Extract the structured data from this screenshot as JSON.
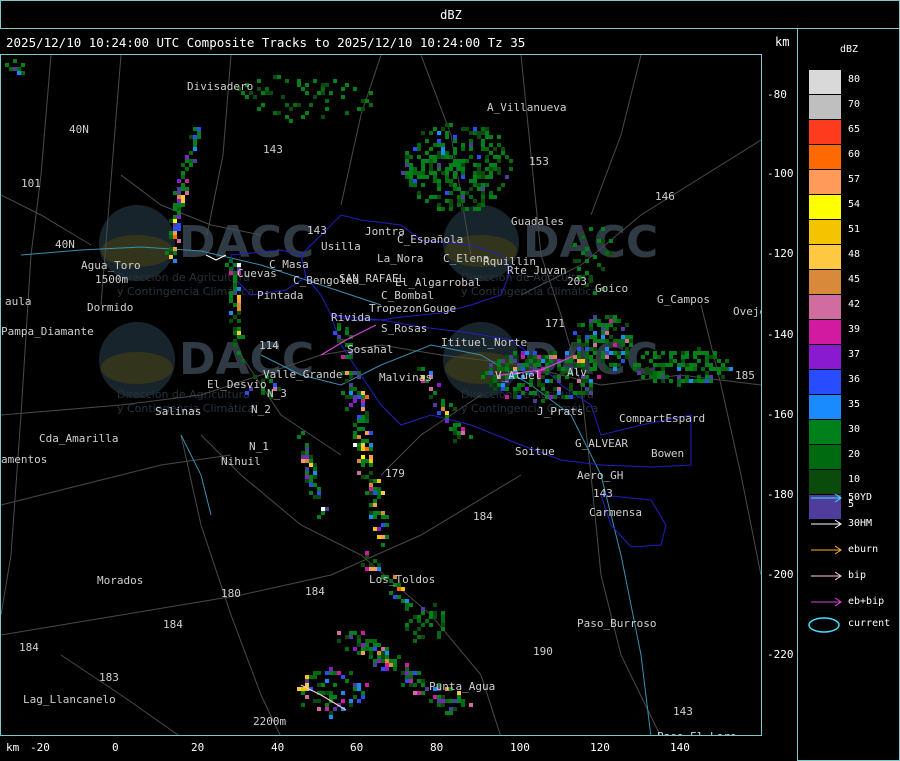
{
  "header": {
    "title": "dBZ"
  },
  "map_title": "2025/12/10 10:24:00 UTC Composite Tracks to 2025/12/10 10:24:00 Tz 35",
  "axis": {
    "unit": "km",
    "y_ticks": [
      "-80",
      "-100",
      "-120",
      "-140",
      "-160",
      "-180",
      "-200",
      "-220"
    ],
    "x_ticks": [
      "-20",
      "0",
      "20",
      "40",
      "60",
      "80",
      "100",
      "120",
      "140"
    ]
  },
  "legend": {
    "title": "dBZ",
    "levels": [
      {
        "label": "80",
        "color": "#d9d9d9"
      },
      {
        "label": "70",
        "color": "#bfbfbf"
      },
      {
        "label": "65",
        "color": "#ff3b1e"
      },
      {
        "label": "60",
        "color": "#ff6a00"
      },
      {
        "label": "57",
        "color": "#ff9a5a"
      },
      {
        "label": "54",
        "color": "#ffff00"
      },
      {
        "label": "51",
        "color": "#f5c400"
      },
      {
        "label": "48",
        "color": "#ffc840"
      },
      {
        "label": "45",
        "color": "#d88a3a"
      },
      {
        "label": "42",
        "color": "#d06ca0"
      },
      {
        "label": "39",
        "color": "#d21aa0"
      },
      {
        "label": "37",
        "color": "#8a1ad0"
      },
      {
        "label": "36",
        "color": "#2a4cff"
      },
      {
        "label": "35",
        "color": "#1a8aff"
      },
      {
        "label": "30",
        "color": "#00801a"
      },
      {
        "label": "20",
        "color": "#006a10"
      },
      {
        "label": "10",
        "color": "#0a4a0a"
      },
      {
        "label": "5",
        "color": "#503c9a"
      }
    ],
    "tracks": [
      {
        "label": "50YD",
        "color": "#40e0ff"
      },
      {
        "label": "30HM",
        "color": "#ffffff"
      },
      {
        "label": "eburn",
        "color": "#ffb030"
      },
      {
        "label": "bip",
        "color": "#ffc8e0"
      },
      {
        "label": "eb+bip",
        "color": "#e040e0"
      }
    ],
    "current_label": "current",
    "current_color": "#40e0ff"
  },
  "places": [
    {
      "name": "Divisadero",
      "x": 186,
      "y": 25
    },
    {
      "name": "A_Villanueva",
      "x": 486,
      "y": 46
    },
    {
      "name": "40N",
      "x": 68,
      "y": 68
    },
    {
      "name": "143",
      "x": 262,
      "y": 88
    },
    {
      "name": "153",
      "x": 528,
      "y": 100
    },
    {
      "name": "101",
      "x": 20,
      "y": 122
    },
    {
      "name": "146",
      "x": 654,
      "y": 135
    },
    {
      "name": "Guadales",
      "x": 510,
      "y": 160
    },
    {
      "name": "143",
      "x": 306,
      "y": 169
    },
    {
      "name": "Jontra",
      "x": 364,
      "y": 170
    },
    {
      "name": "Usilla",
      "x": 320,
      "y": 185
    },
    {
      "name": "C_Española",
      "x": 396,
      "y": 178
    },
    {
      "name": "40N",
      "x": 54,
      "y": 183
    },
    {
      "name": "C_Elena",
      "x": 442,
      "y": 197
    },
    {
      "name": "La_Nora",
      "x": 376,
      "y": 197
    },
    {
      "name": "Rquillin",
      "x": 482,
      "y": 200
    },
    {
      "name": "Agua_Toro",
      "x": 80,
      "y": 204
    },
    {
      "name": "C_Masa",
      "x": 268,
      "y": 203
    },
    {
      "name": "Rte_Juvan",
      "x": 506,
      "y": 209
    },
    {
      "name": "Cuevas",
      "x": 236,
      "y": 212
    },
    {
      "name": "1500m",
      "x": 94,
      "y": 218
    },
    {
      "name": "C_Bengolea",
      "x": 292,
      "y": 219
    },
    {
      "name": "SAN_RAFAEL",
      "x": 338,
      "y": 217
    },
    {
      "name": "El_Algarrobal",
      "x": 394,
      "y": 221
    },
    {
      "name": "203",
      "x": 566,
      "y": 220
    },
    {
      "name": "Goico",
      "x": 594,
      "y": 227
    },
    {
      "name": "Pintada",
      "x": 256,
      "y": 234
    },
    {
      "name": "C_Bombal",
      "x": 380,
      "y": 234
    },
    {
      "name": "G_Campos",
      "x": 656,
      "y": 238
    },
    {
      "name": "aula",
      "x": 4,
      "y": 240
    },
    {
      "name": "Tropezon",
      "x": 368,
      "y": 247
    },
    {
      "name": "Gouge",
      "x": 422,
      "y": 247
    },
    {
      "name": "Ovejo",
      "x": 732,
      "y": 250
    },
    {
      "name": "Dormido",
      "x": 86,
      "y": 246
    },
    {
      "name": "Rivida",
      "x": 330,
      "y": 256
    },
    {
      "name": "171",
      "x": 544,
      "y": 262
    },
    {
      "name": "S_Rosas",
      "x": 380,
      "y": 267
    },
    {
      "name": "Pampa_Diamante",
      "x": 0,
      "y": 270
    },
    {
      "name": "Itituel_Norte",
      "x": 440,
      "y": 281
    },
    {
      "name": "114",
      "x": 258,
      "y": 284
    },
    {
      "name": "Sosahal",
      "x": 346,
      "y": 288
    },
    {
      "name": "Valle_Grande",
      "x": 262,
      "y": 313
    },
    {
      "name": "Malvinas",
      "x": 378,
      "y": 316
    },
    {
      "name": "V_Atuel",
      "x": 494,
      "y": 314
    },
    {
      "name": "Alv",
      "x": 566,
      "y": 311
    },
    {
      "name": "185",
      "x": 734,
      "y": 314
    },
    {
      "name": "El_Desvio",
      "x": 206,
      "y": 323
    },
    {
      "name": "N_3",
      "x": 266,
      "y": 332
    },
    {
      "name": "Salinas",
      "x": 154,
      "y": 350
    },
    {
      "name": "N_2",
      "x": 250,
      "y": 348
    },
    {
      "name": "J_Prats",
      "x": 536,
      "y": 350
    },
    {
      "name": "CompartEspard",
      "x": 618,
      "y": 357
    },
    {
      "name": "Cda_Amarilla",
      "x": 38,
      "y": 377
    },
    {
      "name": "N_1",
      "x": 248,
      "y": 385
    },
    {
      "name": "G_ALVEAR",
      "x": 574,
      "y": 382
    },
    {
      "name": "Soitue",
      "x": 514,
      "y": 390
    },
    {
      "name": "Bowen",
      "x": 650,
      "y": 392
    },
    {
      "name": "amentos",
      "x": 0,
      "y": 398
    },
    {
      "name": "Nihuil",
      "x": 220,
      "y": 400
    },
    {
      "name": "179",
      "x": 384,
      "y": 412
    },
    {
      "name": "Aero_GH",
      "x": 576,
      "y": 414
    },
    {
      "name": "143",
      "x": 592,
      "y": 432
    },
    {
      "name": "184",
      "x": 472,
      "y": 455
    },
    {
      "name": "Carmensa",
      "x": 588,
      "y": 451
    },
    {
      "name": "Morados",
      "x": 96,
      "y": 519
    },
    {
      "name": "Los_Toldos",
      "x": 368,
      "y": 518
    },
    {
      "name": "184",
      "x": 304,
      "y": 530
    },
    {
      "name": "180",
      "x": 220,
      "y": 532
    },
    {
      "name": "184",
      "x": 162,
      "y": 563
    },
    {
      "name": "Paso_Burroso",
      "x": 576,
      "y": 562
    },
    {
      "name": "184",
      "x": 18,
      "y": 586
    },
    {
      "name": "190",
      "x": 532,
      "y": 590
    },
    {
      "name": "Punta_Agua",
      "x": 428,
      "y": 625
    },
    {
      "name": "183",
      "x": 98,
      "y": 616
    },
    {
      "name": "Lag_Llancanelo",
      "x": 22,
      "y": 638
    },
    {
      "name": "143",
      "x": 672,
      "y": 650
    },
    {
      "name": "2200m",
      "x": 252,
      "y": 660
    },
    {
      "name": "Paso_El_Loro",
      "x": 656,
      "y": 675
    }
  ],
  "watermark": {
    "logo": "DACC",
    "line1": "Dirección de Agricultura",
    "line2": "y Contingencia Climática"
  }
}
